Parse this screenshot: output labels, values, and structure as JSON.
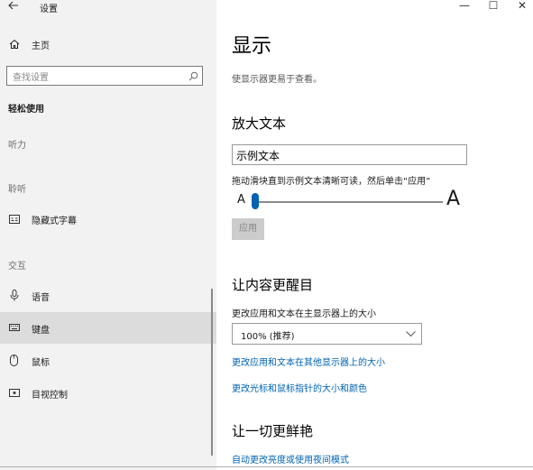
{
  "window": {
    "title": "设置",
    "minimize": "—",
    "maximize": "☐",
    "close": "✕"
  },
  "sidebar": {
    "home": "主页",
    "search_placeholder": "查找设置",
    "section_title": "轻松使用",
    "groups": {
      "hearing": "听力",
      "listening": "聆听",
      "interaction": "交互"
    },
    "items": [
      {
        "label": "隐藏式字幕",
        "icon": "closed-caption-icon"
      },
      {
        "label": "语音",
        "icon": "microphone-icon"
      },
      {
        "label": "键盘",
        "icon": "keyboard-icon"
      },
      {
        "label": "鼠标",
        "icon": "mouse-icon"
      },
      {
        "label": "目视控制",
        "icon": "eye-control-icon"
      }
    ],
    "selected_item": "键盘"
  },
  "main": {
    "title": "显示",
    "description": "使显示器更易于查看。",
    "enlarge_text": {
      "heading": "放大文本",
      "sample_text": "示例文本",
      "instruction": "拖动滑块直到示例文本清晰可读，然后单击“应用”",
      "small_label": "A",
      "large_label": "A",
      "slider_value": 0,
      "apply_label": "应用"
    },
    "make_bigger": {
      "heading": "让内容更醒目",
      "scale_label": "更改应用和文本在主显示器上的大小",
      "scale_value": "100% (推荐)",
      "link_other_displays": "更改应用和文本在其他显示器上的大小",
      "link_cursor": "更改光标和鼠标指针的大小和颜色"
    },
    "brighter": {
      "heading": "让一切更鲜艳",
      "link_brightness": "自动更改亮度或使用夜间模式"
    }
  },
  "colors": {
    "accent": "#0063b1",
    "sidebar_bg": "#f2f2f2",
    "selected_bg": "#dcdcdc"
  }
}
